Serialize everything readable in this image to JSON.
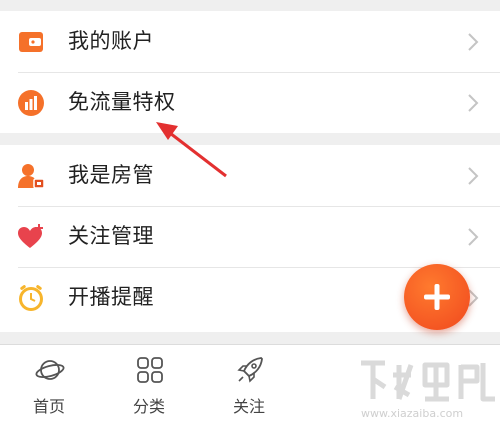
{
  "menu_group_1": [
    {
      "label": "我的账户",
      "icon": "wallet-icon"
    },
    {
      "label": "免流量特权",
      "icon": "data-bars-icon"
    }
  ],
  "menu_group_2": [
    {
      "label": "我是房管",
      "icon": "room-admin-icon"
    },
    {
      "label": "关注管理",
      "icon": "heart-plus-icon"
    },
    {
      "label": "开播提醒",
      "icon": "alarm-clock-icon"
    }
  ],
  "bottom_nav": [
    {
      "label": "首页",
      "icon": "planet-icon"
    },
    {
      "label": "分类",
      "icon": "category-grid-icon"
    },
    {
      "label": "关注",
      "icon": "rocket-icon"
    }
  ],
  "watermark": {
    "site": "www.xiazaiba.com"
  },
  "colors": {
    "accent": "#f5712a",
    "fab": "#f0481e",
    "annotation": "#e33030"
  }
}
